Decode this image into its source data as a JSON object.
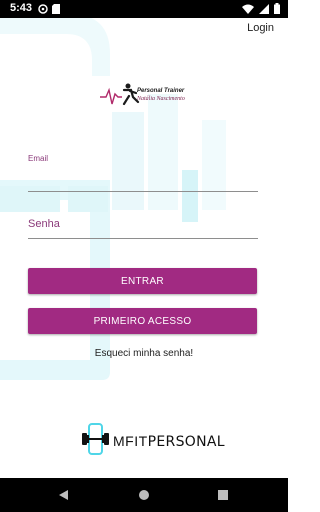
{
  "status_bar": {
    "time": "5:43"
  },
  "header": {
    "login_label": "Login"
  },
  "logo": {
    "title": "Personal Trainer",
    "name": "Natália Nascimento"
  },
  "form": {
    "email_label": "Email",
    "email_value": "",
    "password_label": "Senha",
    "password_value": ""
  },
  "buttons": {
    "enter_label": "ENTRAR",
    "first_access_label": "PRIMEIRO ACESSO"
  },
  "forgot_password": "Esqueci minha senha!",
  "brand": {
    "part1": "MFIT",
    "part2": "PERSONAL"
  },
  "colors": {
    "primary": "#a12a82",
    "accent_cyan": "#4fd6e8",
    "label": "#8b3a7a"
  }
}
